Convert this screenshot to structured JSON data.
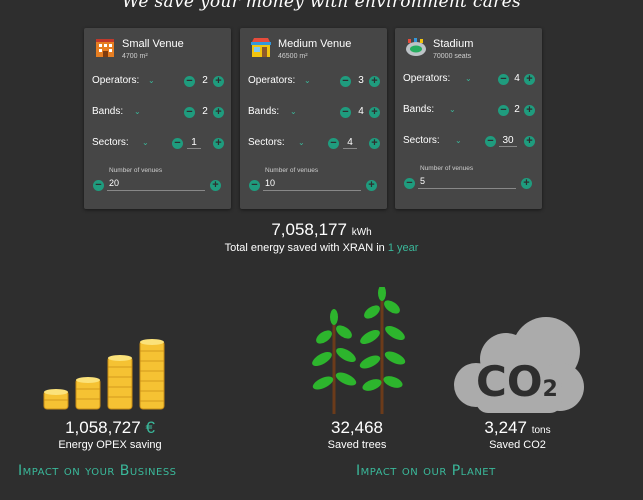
{
  "tagline": "We save your money with environment cares",
  "cards": [
    {
      "name": "Small Venue",
      "sub": "4700 m²",
      "operators_label": "Operators:",
      "operators": "2",
      "bands_label": "Bands:",
      "bands": "2",
      "sectors_label": "Sectors:",
      "sectors": "1",
      "venues_label": "Number of venues",
      "venues": "20"
    },
    {
      "name": "Medium Venue",
      "sub": "46500 m²",
      "operators_label": "Operators:",
      "operators": "3",
      "bands_label": "Bands:",
      "bands": "4",
      "sectors_label": "Sectors:",
      "sectors": "4",
      "venues_label": "Number of venues",
      "venues": "10"
    },
    {
      "name": "Stadium",
      "sub": "70000 seats",
      "operators_label": "Operators:",
      "operators": "4",
      "bands_label": "Bands:",
      "bands": "2",
      "sectors_label": "Sectors:",
      "sectors": "30",
      "venues_label": "Number of venues",
      "venues": "5"
    }
  ],
  "total": {
    "value": "7,058,177",
    "unit": "kWh",
    "text_prefix": "Total energy saved with XRAN in",
    "period": "1 year"
  },
  "opex": {
    "value": "1,058,727",
    "currency": "€",
    "label": "Energy OPEX saving"
  },
  "trees": {
    "value": "32,468",
    "label": "Saved trees"
  },
  "co2": {
    "value": "3,247",
    "unit": "tons",
    "label": "Saved CO2",
    "cloud_text": "CO",
    "cloud_sub": "2"
  },
  "impact_business": "Impact on your Business",
  "impact_planet": "Impact on our Planet",
  "colors": {
    "accent": "#3ab89a",
    "card": "#464646",
    "background": "#2e2e2e",
    "coin": "#f5c233"
  }
}
